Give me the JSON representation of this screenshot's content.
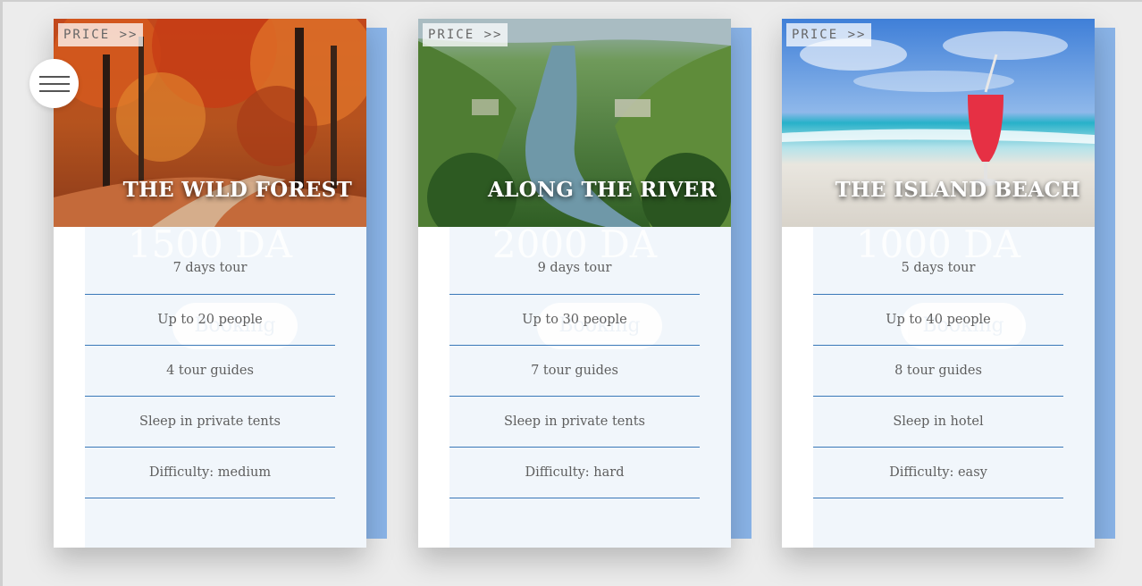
{
  "menu": {
    "icon": "hamburger-menu-icon"
  },
  "cards": [
    {
      "price_tag": "PRICE >>",
      "title": "THE WILD FOREST",
      "price": "1500 DA",
      "cta": "Booking",
      "details": [
        "7 days tour",
        "Up to 20 people",
        "4 tour guides",
        "Sleep in private tents",
        "Difficulty: medium"
      ]
    },
    {
      "price_tag": "PRICE >>",
      "title": "ALONG THE RIVER",
      "price": "2000 DA",
      "cta": "Booking",
      "details": [
        "9 days tour",
        "Up to 30 people",
        "7 tour guides",
        "Sleep in private tents",
        "Difficulty: hard"
      ]
    },
    {
      "price_tag": "PRICE >>",
      "title": "THE ISLAND BEACH",
      "price": "1000 DA",
      "cta": "Booking",
      "details": [
        "5 days tour",
        "Up to 40 people",
        "8 tour guides",
        "Sleep in hotel",
        "Difficulty: easy"
      ]
    }
  ],
  "colors": {
    "accent": "#8ab4e8",
    "divider": "#3a78b8",
    "panel": "#f1f6fb"
  }
}
